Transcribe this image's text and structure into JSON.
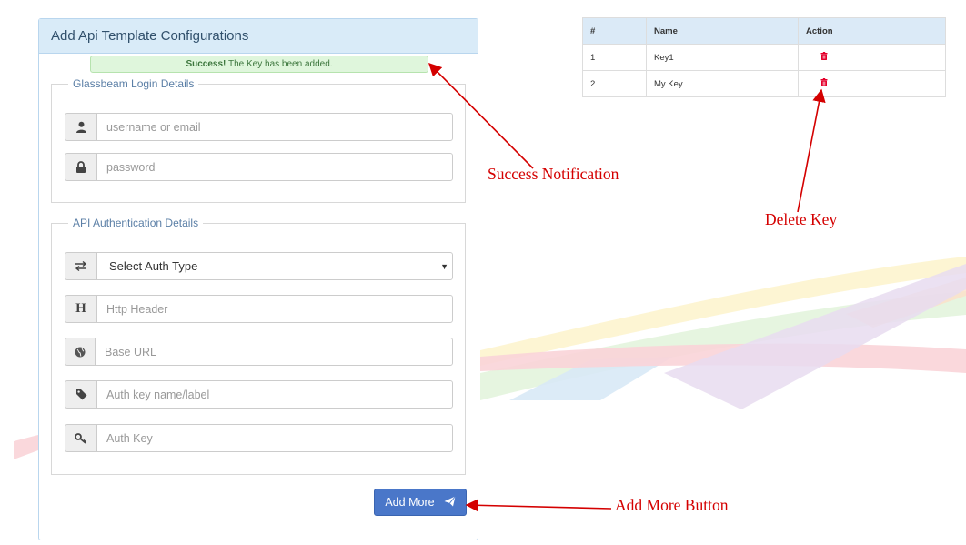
{
  "panel": {
    "title": "Add Api Template Configurations",
    "alert": {
      "strong": "Success!",
      "text": "The Key has been added."
    },
    "login_section": {
      "legend": "Glassbeam Login Details",
      "username_placeholder": "username or email",
      "password_placeholder": "password",
      "username_icon": "user-icon",
      "password_icon": "lock-icon"
    },
    "auth_section": {
      "legend": "API Authentication Details",
      "auth_type": {
        "selected": "Select Auth Type",
        "icon": "exchange-icon"
      },
      "http_header_placeholder": "Http Header",
      "http_header_icon_glyph": "H",
      "base_url_placeholder": "Base URL",
      "auth_key_name_placeholder": "Auth key name/label",
      "auth_key_placeholder": "Auth Key"
    },
    "add_more_button": "Add More"
  },
  "keys_table": {
    "headers": [
      "#",
      "Name",
      "Action"
    ],
    "rows": [
      {
        "num": "1",
        "name": "Key1"
      },
      {
        "num": "2",
        "name": "My Key"
      }
    ]
  },
  "annotations": {
    "success": "Success Notification",
    "delete": "Delete Key",
    "add_more": "Add More Button"
  },
  "colors": {
    "annotation": "#d40000",
    "button": "#4a77c9",
    "panel_header": "#d9ebf8",
    "alert_bg": "#dff6dc",
    "delete_icon": "#e4002b"
  }
}
